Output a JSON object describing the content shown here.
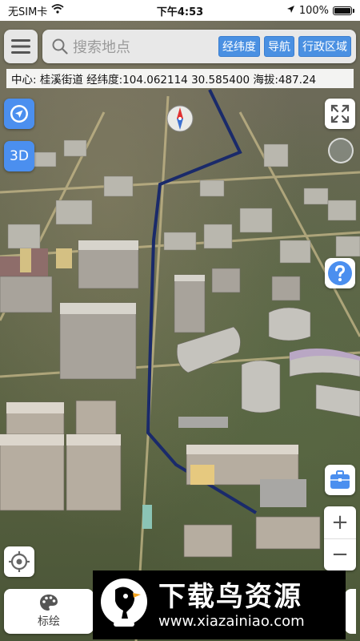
{
  "status_bar": {
    "carrier": "无SIM卡",
    "time": "下午4:53",
    "battery_percent": "100%",
    "battery_level": 1.0,
    "icons": [
      "wifi-icon",
      "location-arrow-icon",
      "battery-icon"
    ]
  },
  "header": {
    "menu_icon": "hamburger-icon",
    "search": {
      "placeholder": "搜索地点",
      "icon": "search-icon"
    },
    "buttons": {
      "coordinates": "经纬度",
      "navigation": "导航",
      "admin_region": "行政区域"
    }
  },
  "info_bar": {
    "text": "中心: 桂溪街道 经纬度:104.062114 30.585400 海拔:487.24"
  },
  "left_controls": {
    "location_toggle_icon": "navigation-circle-icon",
    "mode_3d_label": "3D",
    "locate_icon": "crosshair-icon"
  },
  "right_controls": {
    "fullscreen_icon": "expand-arrows-icon",
    "help_icon": "question-icon",
    "toolbox_icon": "briefcase-icon",
    "zoom_in": "+",
    "zoom_out": "−"
  },
  "compass_icon": "compass-icon",
  "bottom": {
    "draw_label": "标绘",
    "draw_icon": "palette-icon"
  },
  "watermark": {
    "title": "下载鸟资源",
    "url": "www.xiazainiao.com",
    "logo": "bird-logo"
  },
  "colors": {
    "accent": "#4b8fef",
    "chip": "#4a90e2",
    "route": "#1a2a6a"
  }
}
